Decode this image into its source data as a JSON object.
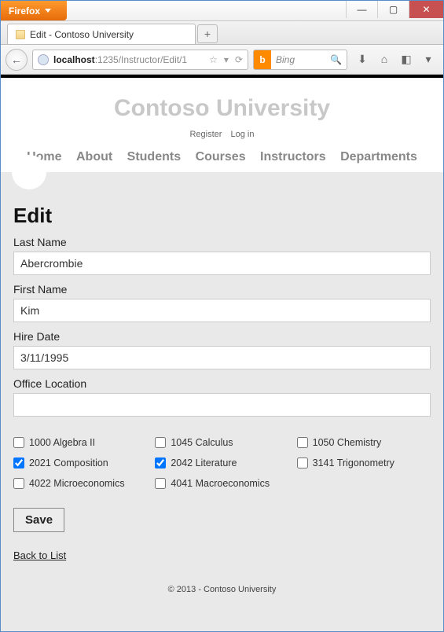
{
  "browser": {
    "firefox_label": "Firefox",
    "tab_title": "Edit - Contoso University",
    "new_tab_glyph": "+",
    "url_host": "localhost",
    "url_path": ":1235/Instructor/Edit/1",
    "search_engine": "Bing",
    "search_icon_glyph": "b",
    "back_glyph": "←",
    "reload_glyph": "⟳",
    "star_glyph": "☆",
    "dropdown_glyph": "▾",
    "magnifier_glyph": "🔍",
    "download_glyph": "⬇",
    "home_glyph": "⌂",
    "bookmark_glyph": "◧",
    "minimize_glyph": "—",
    "maximize_glyph": "▢",
    "close_glyph": "✕"
  },
  "site": {
    "title": "Contoso University",
    "register": "Register",
    "login": "Log in",
    "nav": {
      "home": "Home",
      "about": "About",
      "students": "Students",
      "courses": "Courses",
      "instructors": "Instructors",
      "departments": "Departments"
    }
  },
  "page": {
    "heading": "Edit",
    "labels": {
      "last_name": "Last Name",
      "first_name": "First Name",
      "hire_date": "Hire Date",
      "office": "Office Location"
    },
    "values": {
      "last_name": "Abercrombie",
      "first_name": "Kim",
      "hire_date": "3/11/1995",
      "office": ""
    },
    "courses": [
      {
        "label": "1000 Algebra II",
        "checked": false
      },
      {
        "label": "1045 Calculus",
        "checked": false
      },
      {
        "label": "1050 Chemistry",
        "checked": false
      },
      {
        "label": "2021 Composition",
        "checked": true
      },
      {
        "label": "2042 Literature",
        "checked": true
      },
      {
        "label": "3141 Trigonometry",
        "checked": false
      },
      {
        "label": "4022 Microeconomics",
        "checked": false
      },
      {
        "label": "4041 Macroeconomics",
        "checked": false
      }
    ],
    "save_label": "Save",
    "back_label": "Back to List"
  },
  "footer": "© 2013 - Contoso University"
}
